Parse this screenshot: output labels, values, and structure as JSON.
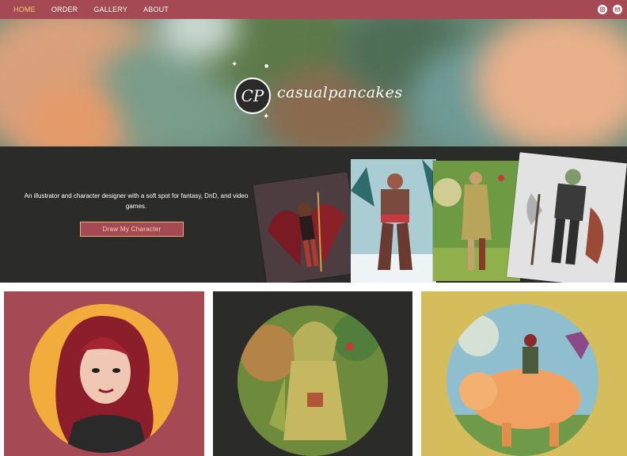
{
  "nav": {
    "items": [
      {
        "label": "HOME",
        "active": true
      },
      {
        "label": "ORDER",
        "active": false
      },
      {
        "label": "GALLERY",
        "active": false
      },
      {
        "label": "ABOUT",
        "active": false
      }
    ],
    "social_icons": [
      "instagram-icon",
      "email-icon"
    ]
  },
  "hero": {
    "logo_monogram": "CP",
    "logo_text": "casualpancakes"
  },
  "intro": {
    "tagline": "An illustrator and character designer with a soft spot for fantasy, DnD, and video games.",
    "cta_label": "Draw My Character"
  },
  "colors": {
    "nav_bg": "#a54a55",
    "active_nav": "#f3c96a",
    "intro_bg": "#2b2b29",
    "tile_red": "#a54a55",
    "tile_dark": "#2b2b29",
    "tile_gold": "#d6bd5c"
  }
}
